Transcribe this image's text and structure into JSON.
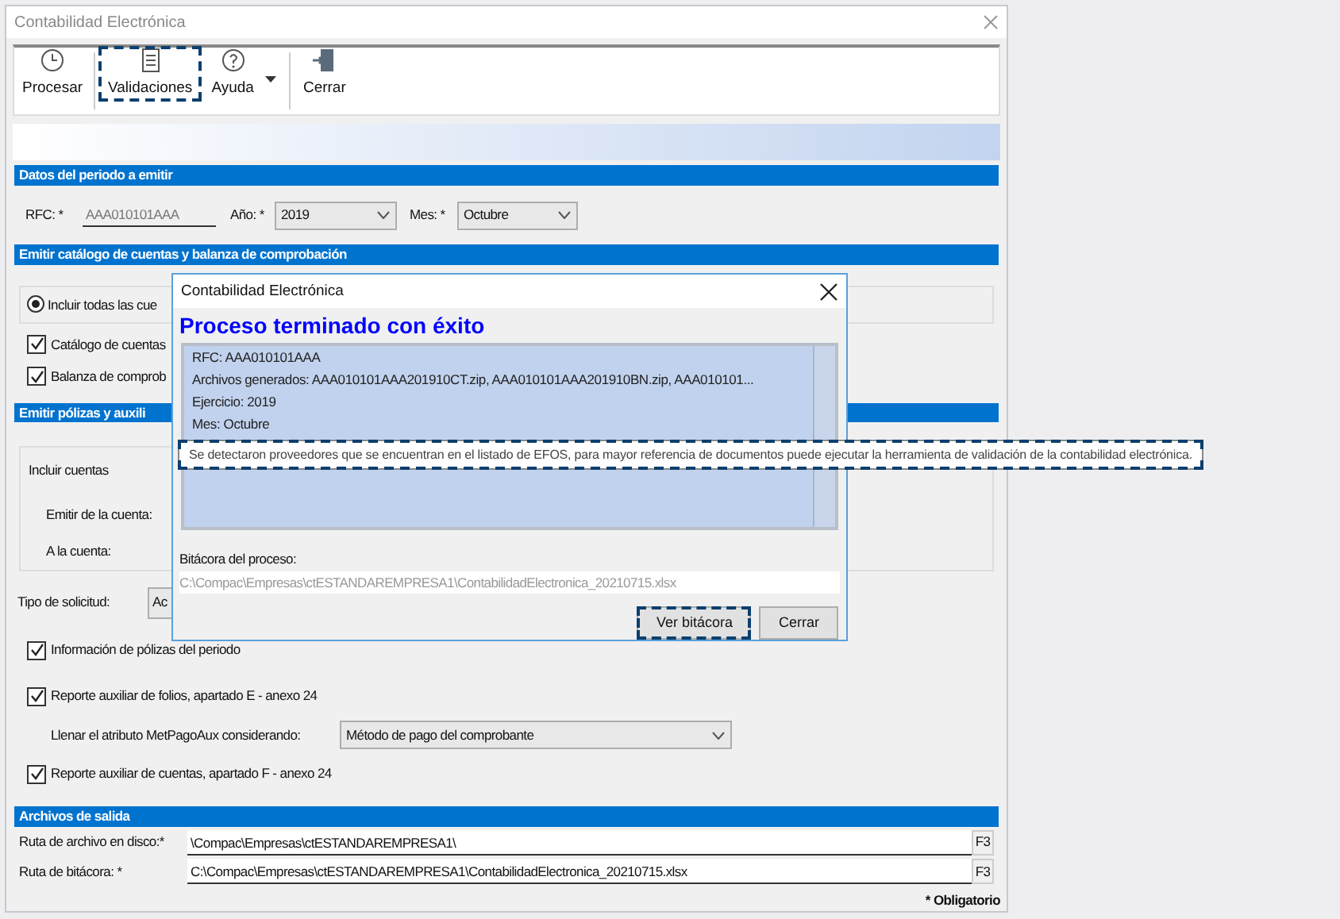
{
  "window": {
    "title": "Contabilidad Electrónica",
    "toolbar": [
      {
        "label": "Procesar",
        "kind": "clock",
        "dropdown": false,
        "highlighted": false
      },
      {
        "label": "Validaciones",
        "kind": "list",
        "dropdown": false,
        "highlighted": true
      },
      {
        "label": "Ayuda",
        "kind": "help",
        "dropdown": true,
        "highlighted": false
      },
      {
        "label": "Cerrar",
        "kind": "exit",
        "dropdown": false,
        "highlighted": false
      }
    ]
  },
  "period": {
    "title": "Datos del periodo a emitir",
    "rfc_label": "RFC: *",
    "rfc": "AAA010101AAA",
    "year_label": "Año: *",
    "year": "2019",
    "month_label": "Mes: *",
    "month": "Octubre"
  },
  "catalog": {
    "title": "Emitir catálogo de cuentas y balanza de comprobación",
    "radio": {
      "label": "Incluir todas las cue",
      "selected": true
    },
    "checks": [
      {
        "label": "Catálogo de cuentas",
        "checked": true
      },
      {
        "label": "Balanza de comprob",
        "checked": true
      }
    ]
  },
  "polizas": {
    "title": "Emitir pólizas y auxili",
    "group_title": "Incluir cuentas",
    "from_label": "Emitir de la cuenta:",
    "to_label": "A la cuenta:",
    "request_label": "Tipo de solicitud:",
    "request": "Ac",
    "options": [
      {
        "kind": "check",
        "label": "Información de pólizas del periodo",
        "checked": true
      },
      {
        "kind": "check",
        "label": "Reporte auxiliar de folios, apartado E - anexo 24",
        "checked": true
      },
      {
        "kind": "select",
        "label": "Llenar el atributo MetPagoAux considerando:",
        "value": "Método de pago del comprobante"
      },
      {
        "kind": "check",
        "label": "Reporte auxiliar de cuentas, apartado F - anexo 24",
        "checked": true
      }
    ]
  },
  "output": {
    "title": "Archivos de salida",
    "fields": [
      {
        "label": "Ruta de archivo en disco:*",
        "value": "\\Compac\\Empresas\\ctESTANDAREMPRESA1\\",
        "button": "F3"
      },
      {
        "label": "Ruta de bitácora: *",
        "value": "C:\\Compac\\Empresas\\ctESTANDAREMPRESA1\\ContabilidadElectronica_20210715.xlsx",
        "button": "F3"
      }
    ],
    "required_note": "* Obligatorio"
  },
  "dialog": {
    "title": "Contabilidad Electrónica",
    "heading": "Proceso terminado con éxito",
    "lines": [
      "RFC:  AAA010101AAA",
      "Archivos generados:  AAA010101AAA201910CT.zip, AAA010101AAA201910BN.zip, AAA010101...",
      "Ejercicio:  2019",
      "Mes: Octubre"
    ],
    "log_label": "Bitácora del proceso:",
    "log_path": "C:\\Compac\\Empresas\\ctESTANDAREMPRESA1\\ContabilidadElectronica_20210715.xlsx",
    "buttons": [
      {
        "label": "Ver bitácora",
        "highlighted": true
      },
      {
        "label": "Cerrar",
        "highlighted": false
      }
    ]
  },
  "tooltip": {
    "text": "Se detectaron proveedores que se encuentran en el listado de EFOS, para mayor referencia de documentos puede ejecutar la herramienta de validación de la contabilidad electrónica.",
    "highlighted": true
  }
}
